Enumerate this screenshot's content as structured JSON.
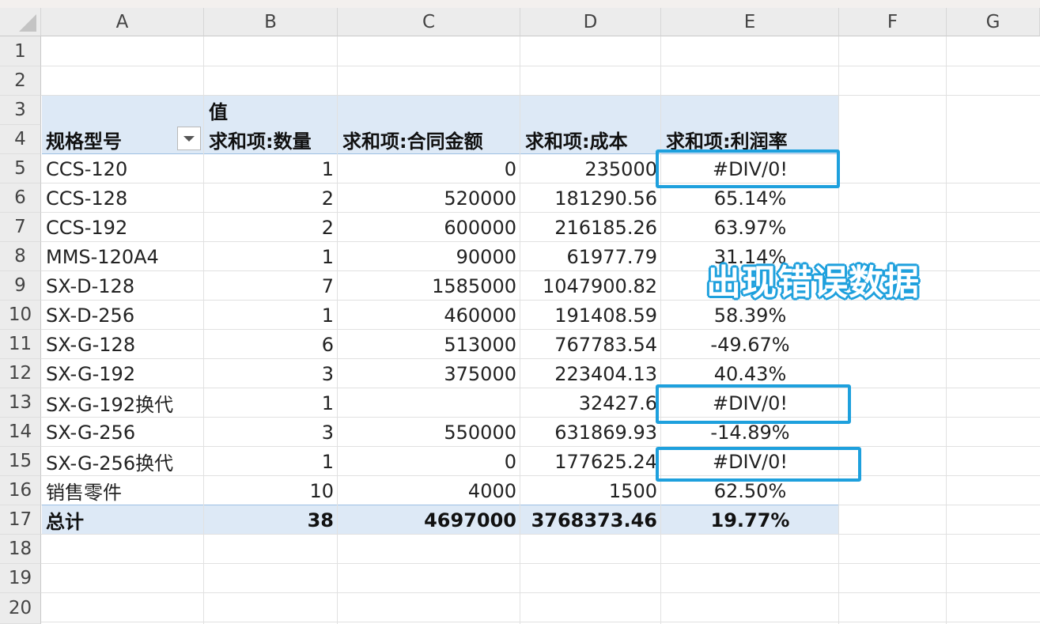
{
  "columns": [
    "A",
    "B",
    "C",
    "D",
    "E",
    "F",
    "G"
  ],
  "rows": [
    "1",
    "2",
    "3",
    "4",
    "5",
    "6",
    "7",
    "8",
    "9",
    "10",
    "11",
    "12",
    "13",
    "14",
    "15",
    "16",
    "17",
    "18",
    "19",
    "20"
  ],
  "pivot": {
    "values_caption": "值",
    "headers": [
      "规格型号",
      "求和项:数量",
      "求和项:合同金额",
      "求和项:成本",
      "求和项:利润率"
    ],
    "records": [
      {
        "model": "CCS-120",
        "qty": "1",
        "amount": "0",
        "cost": "235000",
        "margin": "#DIV/0!"
      },
      {
        "model": "CCS-128",
        "qty": "2",
        "amount": "520000",
        "cost": "181290.56",
        "margin": "65.14%"
      },
      {
        "model": "CCS-192",
        "qty": "2",
        "amount": "600000",
        "cost": "216185.26",
        "margin": "63.97%"
      },
      {
        "model": "MMS-120A4",
        "qty": "1",
        "amount": "90000",
        "cost": "61977.79",
        "margin": "31.14%"
      },
      {
        "model": "SX-D-128",
        "qty": "7",
        "amount": "1585000",
        "cost": "1047900.82",
        "margin": ""
      },
      {
        "model": "SX-D-256",
        "qty": "1",
        "amount": "460000",
        "cost": "191408.59",
        "margin": "58.39%"
      },
      {
        "model": "SX-G-128",
        "qty": "6",
        "amount": "513000",
        "cost": "767783.54",
        "margin": "-49.67%"
      },
      {
        "model": "SX-G-192",
        "qty": "3",
        "amount": "375000",
        "cost": "223404.13",
        "margin": "40.43%"
      },
      {
        "model": "SX-G-192换代",
        "qty": "1",
        "amount": "",
        "cost": "32427.6",
        "margin": "#DIV/0!"
      },
      {
        "model": "SX-G-256",
        "qty": "3",
        "amount": "550000",
        "cost": "631869.93",
        "margin": "-14.89%"
      },
      {
        "model": "SX-G-256换代",
        "qty": "1",
        "amount": "0",
        "cost": "177625.24",
        "margin": "#DIV/0!"
      },
      {
        "model": "销售零件",
        "qty": "10",
        "amount": "4000",
        "cost": "1500",
        "margin": "62.50%"
      }
    ],
    "total": {
      "label": "总计",
      "qty": "38",
      "amount": "4697000",
      "cost": "3768373.46",
      "margin": "19.77%"
    }
  },
  "annotation": {
    "text": "出现错误数据",
    "color": "#1ea0dd"
  },
  "colors": {
    "header_fill": "#dde9f6",
    "highlight_box": "#1ea0dd"
  }
}
